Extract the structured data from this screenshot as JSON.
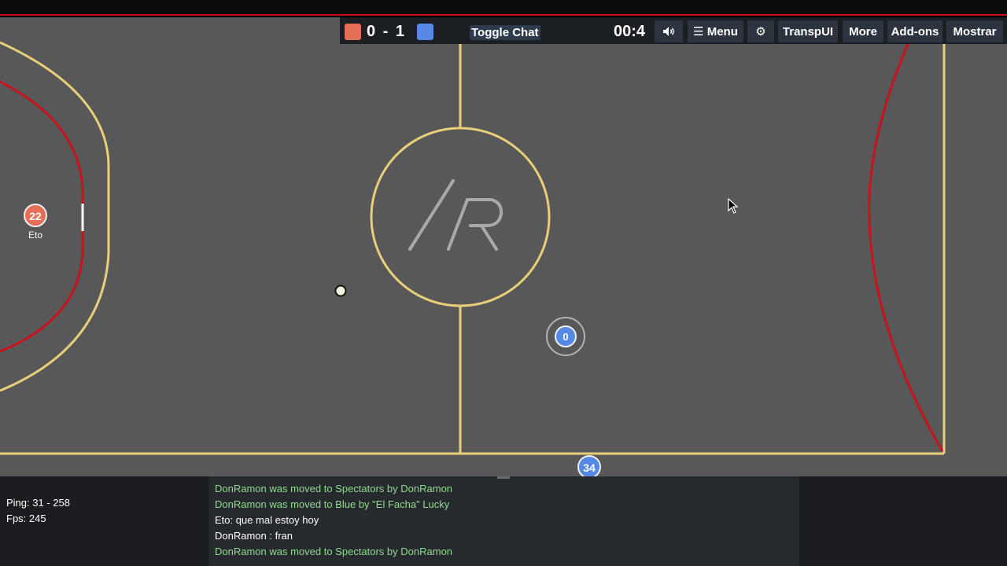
{
  "hud": {
    "red_color": "#e56e56",
    "blue_color": "#5689e5",
    "score": "0 - 1",
    "toggle_chat": "Toggle Chat",
    "timer": "00:4",
    "sound_icon": "volume-icon",
    "menu_label": "☰ Menu",
    "settings_icon": "gear-icon",
    "buttons": [
      "TranspUI",
      "More",
      "Add-ons",
      "Mostrar"
    ]
  },
  "field": {
    "center_logo": "/R",
    "players": [
      {
        "number": "22",
        "name": "Eto",
        "team": "red"
      },
      {
        "number": "0",
        "name": "",
        "team": "blue"
      },
      {
        "number": "34",
        "name": "",
        "team": "blue"
      }
    ]
  },
  "stats": {
    "ping": "Ping: 31 - 258",
    "fps": "Fps: 245"
  },
  "chat": [
    {
      "text": "DonRamon was moved to Spectators by DonRamon",
      "type": "system"
    },
    {
      "text": "DonRamon was moved to Blue by \"El Facha\" Lucky",
      "type": "system"
    },
    {
      "text": "Eto: que mal estoy hoy",
      "type": "msg"
    },
    {
      "text": "DonRamon : fran",
      "type": "msg"
    },
    {
      "text": "DonRamon was moved to Spectators by DonRamon",
      "type": "system"
    }
  ]
}
